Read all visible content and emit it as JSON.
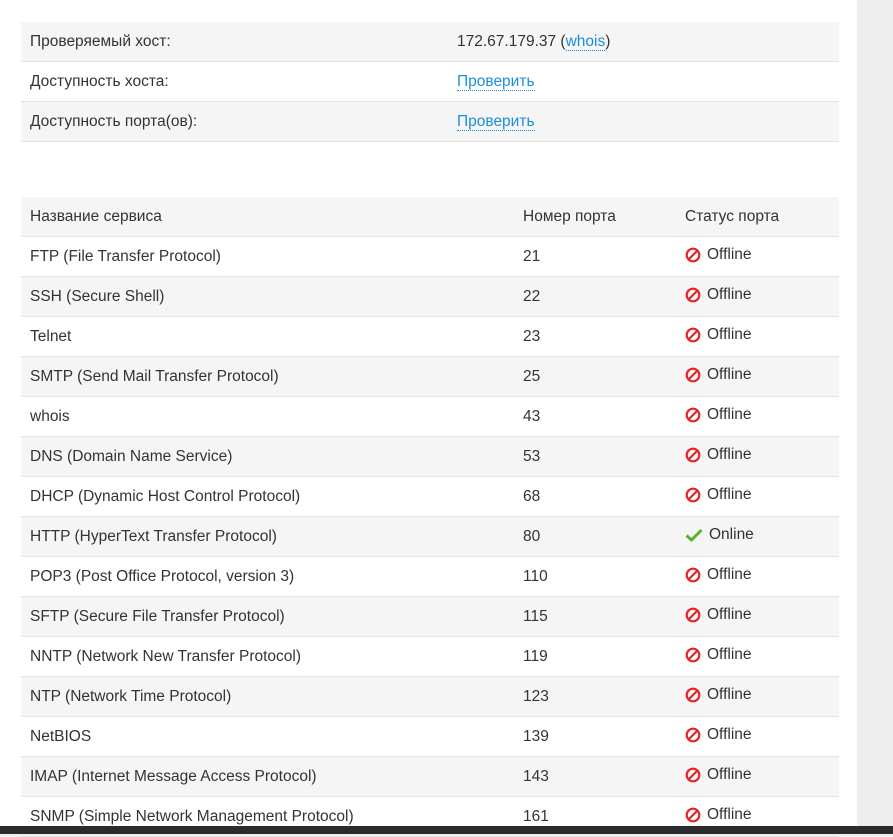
{
  "host_info": {
    "rows": [
      {
        "label": "Проверяемый хост:",
        "value": "172.67.179.37",
        "paren_open": " (",
        "link": "whois",
        "paren_close": ")"
      },
      {
        "label": "Доступность хоста:",
        "link": "Проверить"
      },
      {
        "label": "Доступность порта(ов):",
        "link": "Проверить"
      }
    ]
  },
  "ports": {
    "headers": {
      "service": "Название сервиса",
      "port": "Номер порта",
      "status": "Статус порта"
    },
    "rows": [
      {
        "service": "FTP (File Transfer Protocol)",
        "port": "21",
        "status": "Offline"
      },
      {
        "service": "SSH (Secure Shell)",
        "port": "22",
        "status": "Offline"
      },
      {
        "service": "Telnet",
        "port": "23",
        "status": "Offline"
      },
      {
        "service": "SMTP (Send Mail Transfer Protocol)",
        "port": "25",
        "status": "Offline"
      },
      {
        "service": "whois",
        "port": "43",
        "status": "Offline"
      },
      {
        "service": "DNS (Domain Name Service)",
        "port": "53",
        "status": "Offline"
      },
      {
        "service": "DHCP (Dynamic Host Control Protocol)",
        "port": "68",
        "status": "Offline"
      },
      {
        "service": "HTTP (HyperText Transfer Protocol)",
        "port": "80",
        "status": "Online"
      },
      {
        "service": "POP3 (Post Office Protocol, version 3)",
        "port": "110",
        "status": "Offline"
      },
      {
        "service": "SFTP (Secure File Transfer Protocol)",
        "port": "115",
        "status": "Offline"
      },
      {
        "service": "NNTP (Network New Transfer Protocol)",
        "port": "119",
        "status": "Offline"
      },
      {
        "service": "NTP (Network Time Protocol)",
        "port": "123",
        "status": "Offline"
      },
      {
        "service": "NetBIOS",
        "port": "139",
        "status": "Offline"
      },
      {
        "service": "IMAP (Internet Message Access Protocol)",
        "port": "143",
        "status": "Offline"
      },
      {
        "service": "SNMP (Simple Network Management Protocol)",
        "port": "161",
        "status": "Offline"
      }
    ]
  },
  "colors": {
    "offline": "#e3262b",
    "online": "#5cb02e",
    "link": "#1a8fd6"
  },
  "icons": {
    "offline": "prohibited-icon",
    "online": "checkmark-icon"
  }
}
